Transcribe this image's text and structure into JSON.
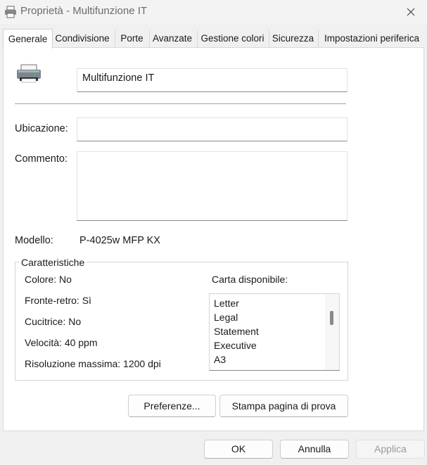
{
  "window": {
    "title": "Proprietà - Multifunzione IT",
    "icon": "printer-icon",
    "close_icon": "close-icon"
  },
  "tabs": [
    {
      "label": "Generale",
      "active": true
    },
    {
      "label": "Condivisione"
    },
    {
      "label": "Porte"
    },
    {
      "label": "Avanzate"
    },
    {
      "label": "Gestione colori"
    },
    {
      "label": "Sicurezza"
    },
    {
      "label": "Impostazioni periferica"
    }
  ],
  "general": {
    "printer_name": "Multifunzione IT",
    "location_label": "Ubicazione:",
    "location_value": "",
    "comment_label": "Commento:",
    "comment_value": "",
    "model_label": "Modello:",
    "model_value": "P-4025w MFP KX"
  },
  "features": {
    "title": "Caratteristiche",
    "items": [
      "Colore: No",
      "Fronte-retro: Sì",
      "Cucitrice: No",
      "Velocità: 40 ppm",
      "Risoluzione massima: 1200 dpi"
    ],
    "paper_label": "Carta disponibile:",
    "paper_list": [
      "Letter",
      "Legal",
      "Statement",
      "Executive",
      "A3"
    ]
  },
  "buttons": {
    "preferences": "Preferenze...",
    "test_page": "Stampa pagina di prova",
    "ok": "OK",
    "cancel": "Annulla",
    "apply": "Applica"
  }
}
